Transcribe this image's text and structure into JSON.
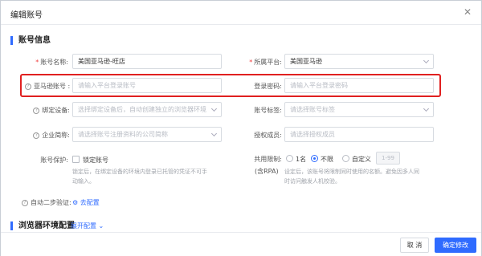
{
  "dialog": {
    "title": "编辑账号",
    "close_icon": "close-icon"
  },
  "section_account": {
    "title": "账号信息"
  },
  "fields": {
    "account_name": {
      "label": "账号名称:",
      "value": "美国亚马逊-旺店"
    },
    "platform": {
      "label": "所属平台:",
      "value": "美国亚马逊"
    },
    "amazon_account": {
      "label": "亚马逊账号 :",
      "placeholder": "请输入平台登录账号"
    },
    "login_password": {
      "label": "登录密码:",
      "placeholder": "请输入平台登录密码"
    },
    "bind_device": {
      "label": "绑定设备:",
      "placeholder": "选择绑定设备后，自动创建独立的浏览器环境"
    },
    "account_tags": {
      "label": "账号标签:",
      "placeholder": "请选择账号标签"
    },
    "company": {
      "label": "企业简称:",
      "placeholder": "请选择账号注册资料的公司简称"
    },
    "authorized_members": {
      "label": "授权成员:",
      "placeholder": "请选择授权成员"
    },
    "account_protect": {
      "label": "账号保护:",
      "checkbox_label": "锁定账号",
      "hint_line1": "锁定后，在绑定设备的环境内登录已托管的凭证不可手",
      "hint_line2": "动输入。"
    },
    "shared_limit": {
      "label": "共用限制:",
      "sublabel": "(含RPA)",
      "options": [
        "1名",
        "不限",
        "自定义"
      ],
      "selected": "不限",
      "custom_value": "1-99",
      "hint_line1": "设定后，该账号将限制同时使用的名额。避免因多人同",
      "hint_line2": "时访问触发人机校验。"
    },
    "two_step": {
      "label": "自动二步验证:",
      "link": "去配置"
    }
  },
  "section_browser": {
    "title": "浏览器环境配置",
    "expand_label": "展开配置"
  },
  "footer": {
    "cancel_label": "取 消",
    "confirm_label": "确定修改"
  },
  "colors": {
    "accent": "#2f6bff",
    "highlight": "#e02020"
  }
}
